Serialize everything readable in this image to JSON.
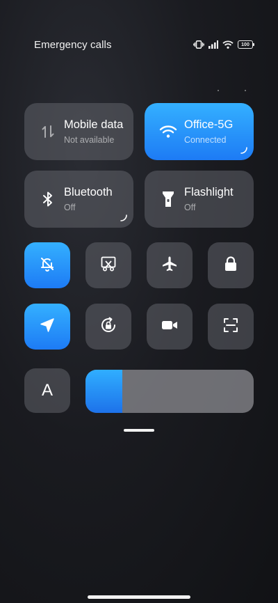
{
  "status_bar": {
    "text": "Emergency calls",
    "battery_level": "100",
    "icons": [
      "vibrate-icon",
      "signal-icon",
      "wifi-icon",
      "battery-icon"
    ]
  },
  "tiles": {
    "mobile_data": {
      "title": "Mobile data",
      "status": "Not available",
      "icon": "data-arrows-icon",
      "active": false
    },
    "wifi": {
      "title": "Office-5G",
      "status": "Connected",
      "icon": "wifi-icon",
      "active": true
    },
    "bluetooth": {
      "title": "Bluetooth",
      "status": "Off",
      "icon": "bluetooth-icon",
      "active": false
    },
    "flashlight": {
      "title": "Flashlight",
      "status": "Off",
      "icon": "flashlight-icon",
      "active": false
    }
  },
  "toggles": [
    {
      "name": "mute-toggle",
      "icon": "bell-off-icon",
      "active": true
    },
    {
      "name": "screenshot-toggle",
      "icon": "scissors-icon",
      "active": false
    },
    {
      "name": "airplane-mode-toggle",
      "icon": "airplane-icon",
      "active": false
    },
    {
      "name": "lock-screen-toggle",
      "icon": "lock-icon",
      "active": false
    },
    {
      "name": "location-toggle",
      "icon": "location-arrow-icon",
      "active": true
    },
    {
      "name": "rotation-lock-toggle",
      "icon": "rotation-lock-icon",
      "active": false
    },
    {
      "name": "screen-record-toggle",
      "icon": "video-camera-icon",
      "active": false
    },
    {
      "name": "scanner-toggle",
      "icon": "scan-icon",
      "active": false
    }
  ],
  "brightness": {
    "auto_label": "A",
    "level_percent": 22
  },
  "colors": {
    "accent": "#1d7bf5",
    "accent_light": "#34b0ff",
    "tile_inactive": "#4a4c52"
  }
}
